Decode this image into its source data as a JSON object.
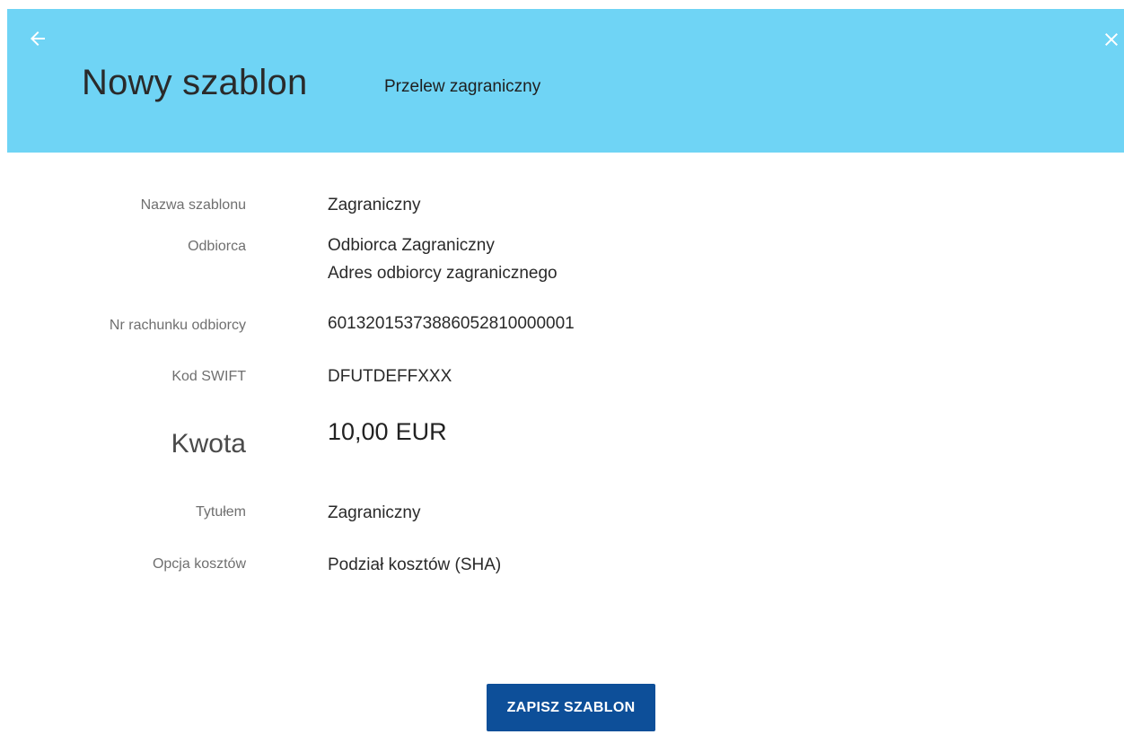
{
  "header": {
    "title": "Nowy szablon",
    "subtitle": "Przelew zagraniczny",
    "background_color": "#6fd4f5",
    "back_icon": "arrow-left-icon",
    "close_icon": "close-icon"
  },
  "details": {
    "template_name": {
      "label": "Nazwa szablonu",
      "value": "Zagraniczny"
    },
    "recipient": {
      "label": "Odbiorca",
      "name": "Odbiorca Zagraniczny",
      "address": "Adres odbiorcy zagranicznego"
    },
    "account_number": {
      "label": "Nr rachunku odbiorcy",
      "value": "60132015373886052810000001"
    },
    "swift": {
      "label": "Kod SWIFT",
      "value": "DFUTDEFFXXX"
    },
    "amount": {
      "label": "Kwota",
      "value": "10,00",
      "currency": "EUR"
    },
    "title": {
      "label": "Tytułem",
      "value": "Zagraniczny"
    },
    "cost_option": {
      "label": "Opcja kosztów",
      "value": "Podział kosztów (SHA)"
    }
  },
  "actions": {
    "save_label": "ZAPISZ SZABLON",
    "save_color": "#0d4f99"
  }
}
